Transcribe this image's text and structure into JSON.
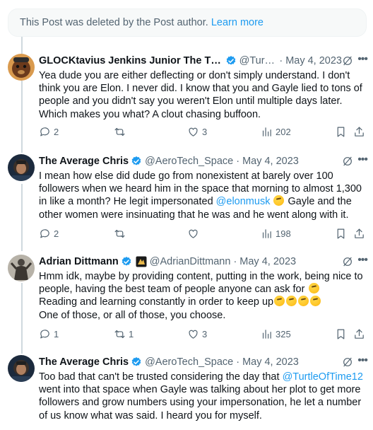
{
  "deleted_notice": {
    "text": "This Post was deleted by the Post author.",
    "link": "Learn more"
  },
  "posts": [
    {
      "name": "GLOCKtavius Jenkins Junior The Thir...",
      "handle": "@Turtl...",
      "date": "May 4, 2023",
      "body": [
        "Yea dude you are either deflecting or don't simply understand. I don't think you are Elon. I never did. I know that you and Gayle lied to tons of people and you didn't say you weren't Elon until multiple days later. Which makes you what? A clout chasing buffoon."
      ],
      "replies": "2",
      "reposts": "",
      "likes": "3",
      "views": "202"
    },
    {
      "name": "The Average Chris",
      "handle": "@AeroTech_Space",
      "date": "May 4, 2023",
      "body_parts": {
        "a": "I mean how else did dude go from nonexistent at barely over 100 followers when we heard him in the space that morning to almost 1,300 in like a month? He legit impersonated ",
        "mention": "@elonmusk",
        "b": " Gayle and the other women were insinuating that he was and he went along with it."
      },
      "replies": "2",
      "reposts": "",
      "likes": "",
      "views": "198"
    },
    {
      "name": "Adrian Dittmann",
      "handle": "@AdrianDittmann",
      "date": "May 4, 2023",
      "body_parts": {
        "line1": "Hmm idk, maybe by providing content, putting in the work, being nice to people, having the best team of people anyone can ask for",
        "line2": "Reading and learning constantly in order to keep up",
        "line3": "One of those, or all of those, you choose."
      },
      "replies": "1",
      "reposts": "1",
      "likes": "3",
      "views": "325"
    },
    {
      "name": "The Average Chris",
      "handle": "@AeroTech_Space",
      "date": "May 4, 2023",
      "body_parts": {
        "a": "Too bad that can't be trusted considering the day that ",
        "mention": "@TurtleOfTime12",
        "b": " went into that space when Gayle was talking about her plot to get more followers and grow numbers using your impersonation, he let a number of us know what was said. I heard you for myself."
      }
    }
  ],
  "colors": {
    "accent": "#1d9bf0",
    "verified": "#1d9bf0",
    "muted": "#536471"
  }
}
